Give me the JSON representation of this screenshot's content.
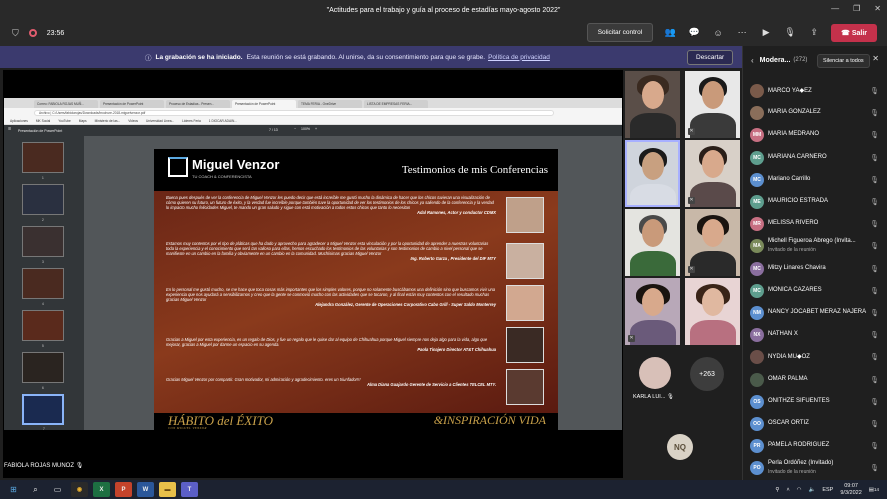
{
  "window": {
    "title": "\"Actitudes para el trabajo y guía al proceso de estadías mayo-agosto 2022\""
  },
  "toolbar": {
    "timer": "23:56",
    "request_control": "Solicitar control",
    "leave": "Salir"
  },
  "banner": {
    "bold": "La grabación se ha iniciado.",
    "text": "Esta reunión se está grabando. Al unirse, da su consentimiento para que se grabe.",
    "link": "Política de privacidad",
    "dismiss": "Descartar"
  },
  "browser": {
    "tabs": [
      "Correo: FABIOLA ROJAS MUÑ...",
      "Presentación de PowerPoint",
      "Proceso de Estadías - Presen...",
      "Presentación de PowerPoint",
      "TEMA FERIA - OneDrive",
      "LISTA DE EMPRESAS FERIA..."
    ],
    "address": "Archivo | C:/Users/fabiolarojas/Downloads/brochure-2018-miguelvenzor.pdf",
    "bookmarks": [
      "Aplicaciones",
      "MK Social",
      "YouTube",
      "Maps",
      "Ministerio de las...",
      "Videos",
      "Universidad Linea...",
      "Lideres Feria",
      "1 DIOCAR ADAIN..."
    ],
    "pdf_title": "Presentación de PowerPoint",
    "page_indicator": "7 / 13",
    "zoom": "100%"
  },
  "thumbs": [
    "1",
    "2",
    "3",
    "4",
    "5",
    "6",
    "7"
  ],
  "slide": {
    "brand": "Miguel Venzor",
    "brand_sub": "TU COACH & CONFERENCISTA",
    "title": "Testimonios de mis Conferencias",
    "testimonials": [
      {
        "text": "Buena pues después de ver la conferencia de Miguel Venzor les puedo decir que está increíble me gustó mucho la dinámica de hacer que los chicos tuvieran una visualización de cómo quieren su futuro, un futuro de éxito, y la verdad fue increíble porque también tuve la oportunidad de ver los testimonios de los chicos ya saliendo de la conferencia y la verdad lo impacto mucho felicidades Miguel, te mando un gran saludo y sigue con está motivación a todos estos chicos que tanto lo necesitan",
        "author": "Adal Ramones, Actor y conductor CDMX"
      },
      {
        "text": "Estamos muy contentos por el tipo de pláticas que ha dado y aprovecho para agradecer a Miguel Venzor esta vinculación y por la oportunidad de aprender a nuestras voluntarias toda la experiencia y el conocimiento que será tan valioso para ellas, hemos escuchado los testimonios de las voluntarias y son testimonios de cambio a nivel personal que se manifieste en un cambio en la familia y obviamente en un cambio en la comunidad. Muchísimas gracias Miguel Venzor",
        "author": "Ing. Roberto Garza , Presidente del DIF MTY"
      },
      {
        "text": "En lo personal me gustó mucho, se me hace que toca cosas más importantes que los simples valores, porque no solamente buscábamos una definición sino que buscamos vivir una experiencia que nos ayudará a sensibilizarnos y creo que la gente se conmovió mucho con las actividades que se tocaron, y al final están muy contentos con el resultado muchas gracias Miguel Venzor",
        "author": "Alejandra González, Gerente de Operaciones Corporativo Cabo Grill - Super Saldo Monterrey"
      },
      {
        "text": "Gracias a Miguel por esta experiencia, es un regalo de Dios, y fue un regalo que le quise dar al equipo de Chihuahua porque Miguel siempre nos deja algo para la vida, algo que mejorar, gracias a Miguel por darme un espacio en su agenda.",
        "author": "Paola Tinajero Director AT&T Chihuahua"
      },
      {
        "text": "Gracias Miguel Venzor por compartir. Gran motivador, mi admiración y agradecimiento. eres un triunfador!!!",
        "author": "Alma Diana Guajardo Gerente de Servicio a Clientes TELCEL MTY."
      }
    ],
    "footer_left": "HÁBITO del ÉXITO",
    "footer_left_sub": "CON MIGUEL VENZOR",
    "footer_right": "&INSPIRACIÓN VIDA"
  },
  "stage": {
    "presenter": "FABIOLA ROJAS MUNOZ"
  },
  "gallery": {
    "karla_label": "KARLA LUI...",
    "more_count": "+263",
    "nq_initials": "NQ"
  },
  "panel": {
    "title": "Modera...",
    "count": "(272)",
    "mute_all": "Silenciar a todos",
    "participants": [
      {
        "initials": "",
        "name": "MARCO YA◆EZ",
        "sub": "",
        "color": "#7a5a4a"
      },
      {
        "initials": "",
        "name": "MARIA GONZALEZ",
        "sub": "",
        "color": "#8a6e5a"
      },
      {
        "initials": "MM",
        "name": "MARIA MEDRANO",
        "sub": "",
        "color": "#c76f82"
      },
      {
        "initials": "MC",
        "name": "MARIANA CARNERO",
        "sub": "",
        "color": "#5e9e8e"
      },
      {
        "initials": "MC",
        "name": "Mariano Carrillo",
        "sub": "",
        "color": "#5c8fcf"
      },
      {
        "initials": "ME",
        "name": "MAURICIO ESTRADA",
        "sub": "",
        "color": "#5e9e8e"
      },
      {
        "initials": "MR",
        "name": "MELISSA RIVERO",
        "sub": "",
        "color": "#c76f82"
      },
      {
        "initials": "MA",
        "name": "Michell Figueroa Abrego (Invita...",
        "sub": "Invitado de la reunión",
        "color": "#7a8a5a"
      },
      {
        "initials": "MC",
        "name": "Mitzy Linares Chavira",
        "sub": "",
        "color": "#8a6e9e"
      },
      {
        "initials": "MC",
        "name": "MONICA CAZARES",
        "sub": "",
        "color": "#5e9e8e"
      },
      {
        "initials": "NM",
        "name": "NANCY JOCABET MERAZ NAJERA",
        "sub": "",
        "color": "#5c8fcf"
      },
      {
        "initials": "NX",
        "name": "NATHAN X",
        "sub": "",
        "color": "#8a6e9e"
      },
      {
        "initials": "",
        "name": "NYDIA MU◆OZ",
        "sub": "",
        "color": "#6a4e48"
      },
      {
        "initials": "",
        "name": "OMAR PALMA",
        "sub": "",
        "color": "#4a5a4a"
      },
      {
        "initials": "OS",
        "name": "ONITHZE SIFUENTES",
        "sub": "",
        "color": "#5c8fcf"
      },
      {
        "initials": "OO",
        "name": "OSCAR ORTIZ",
        "sub": "",
        "color": "#5c8fcf"
      },
      {
        "initials": "PR",
        "name": "PAMELA RODRIGUEZ",
        "sub": "",
        "color": "#5c8fcf"
      },
      {
        "initials": "PO",
        "name": "Perla Ordóñez (Invitado)",
        "sub": "Invitado de la reunión",
        "color": "#5c8fcf"
      }
    ]
  },
  "taskbar": {
    "lang": "ESP",
    "time": "09:07",
    "date": "9/3/2022",
    "notif": "14"
  }
}
